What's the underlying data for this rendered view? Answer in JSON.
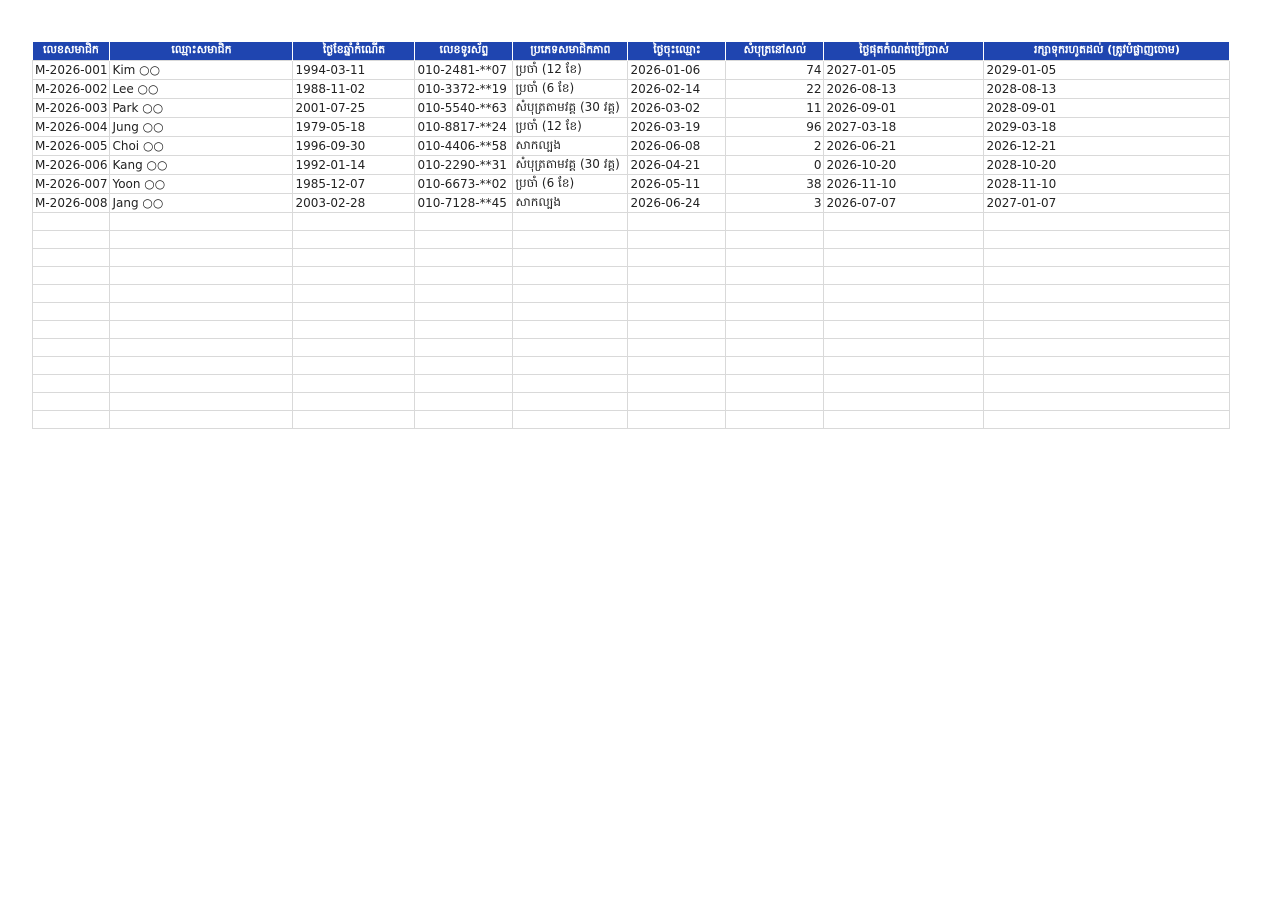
{
  "headers": [
    "លេខសមាជិក",
    "ឈ្មោះសមាជិក",
    "ថ្ងៃខែឆ្នាំកំណើត",
    "លេខទូរស័ព្ទ",
    "ប្រភេទសមាជិកភាព",
    "ថ្ងៃចុះឈ្មោះ",
    "សំបុត្រនៅសល់",
    "ថ្ងៃផុតកំណត់ប្រើប្រាស់",
    "រក្សាទុករហូតដល់ (ត្រូវបំផ្លាញចោម)"
  ],
  "rows": [
    [
      "M-2026-001",
      "Kim ○○",
      "1994-03-11",
      "010-2481-**07",
      "ប្រចាំ (12 ខែ)",
      "2026-01-06",
      "74",
      "2027-01-05",
      "2029-01-05"
    ],
    [
      "M-2026-002",
      "Lee ○○",
      "1988-11-02",
      "010-3372-**19",
      "ប្រចាំ (6 ខែ)",
      "2026-02-14",
      "22",
      "2026-08-13",
      "2028-08-13"
    ],
    [
      "M-2026-003",
      "Park ○○",
      "2001-07-25",
      "010-5540-**63",
      "សំបុត្រតាមវគ្គ (30 វគ្គ)",
      "2026-03-02",
      "11",
      "2026-09-01",
      "2028-09-01"
    ],
    [
      "M-2026-004",
      "Jung ○○",
      "1979-05-18",
      "010-8817-**24",
      "ប្រចាំ (12 ខែ)",
      "2026-03-19",
      "96",
      "2027-03-18",
      "2029-03-18"
    ],
    [
      "M-2026-005",
      "Choi ○○",
      "1996-09-30",
      "010-4406-**58",
      "សាកល្បង",
      "2026-06-08",
      "2",
      "2026-06-21",
      "2026-12-21"
    ],
    [
      "M-2026-006",
      "Kang ○○",
      "1992-01-14",
      "010-2290-**31",
      "សំបុត្រតាមវគ្គ (30 វគ្គ)",
      "2026-04-21",
      "0",
      "2026-10-20",
      "2028-10-20"
    ],
    [
      "M-2026-007",
      "Yoon ○○",
      "1985-12-07",
      "010-6673-**02",
      "ប្រចាំ (6 ខែ)",
      "2026-05-11",
      "38",
      "2026-11-10",
      "2028-11-10"
    ],
    [
      "M-2026-008",
      "Jang ○○",
      "2003-02-28",
      "010-7128-**45",
      "សាកល្បង",
      "2026-06-24",
      "3",
      "2026-07-07",
      "2027-01-07"
    ]
  ],
  "empty_row_count": 12
}
